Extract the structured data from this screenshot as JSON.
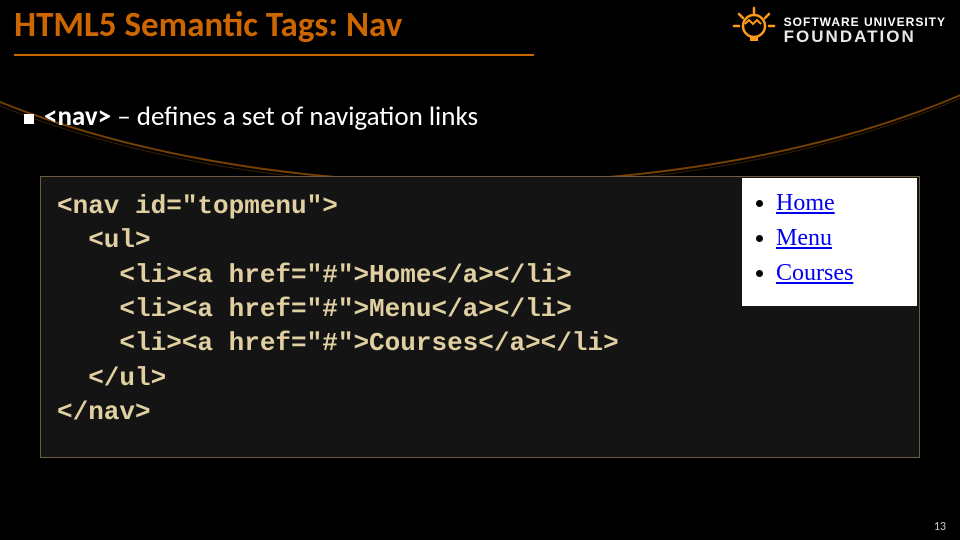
{
  "title": "HTML5 Semantic Tags: Nav",
  "logo": {
    "line1": "SOFTWARE UNIVERSITY",
    "line2": "FOUNDATION"
  },
  "bullet": {
    "tag": "<nav>",
    "rest": " – defines a set of navigation links"
  },
  "code": "<nav id=\"topmenu\">\n  <ul>\n    <li><a href=\"#\">Home</a></li>\n    <li><a href=\"#\">Menu</a></li>\n    <li><a href=\"#\">Courses</a></li>\n  </ul>\n</nav>",
  "preview": {
    "items": [
      "Home",
      "Menu",
      "Courses"
    ]
  },
  "pagenum": "13"
}
